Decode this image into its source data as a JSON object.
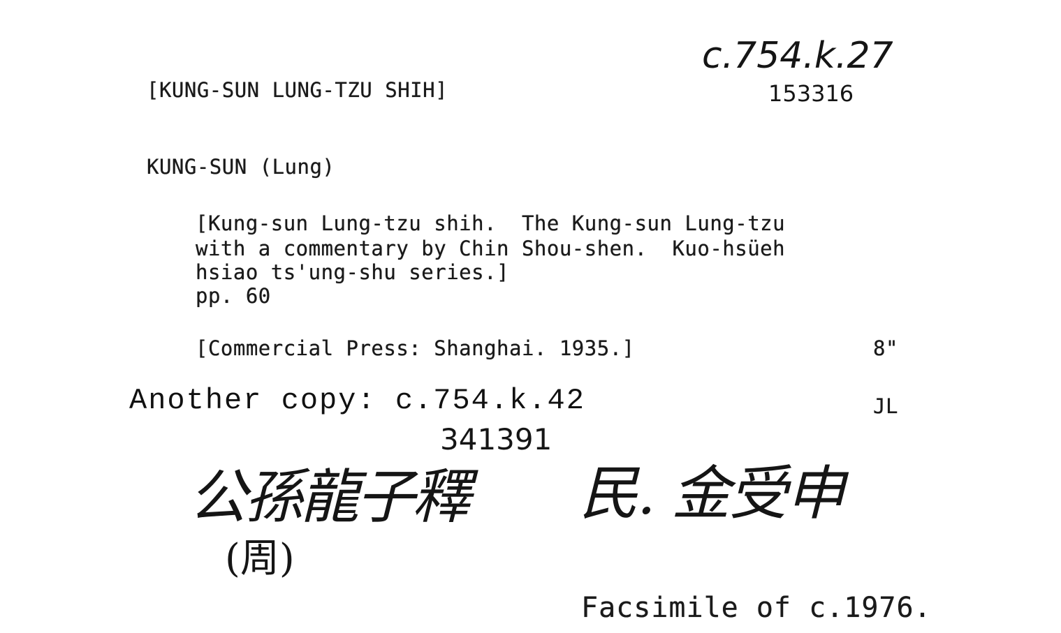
{
  "card": {
    "shelfmark_handwritten": "c.754.k.27",
    "accession_number": "153316",
    "heading_title": "[KUNG-SUN LUNG-TZU SHIH]",
    "author_heading": "KUNG-SUN (Lung)",
    "description_line1": "[Kung-sun Lung-tzu shih.  The Kung-sun Lung-tzu",
    "description_line2": "with a commentary by Chin Shou-shen.  Kuo-hsüeh",
    "description_line3": "hsiao ts'ung-shu series.]",
    "pagination": "pp. 60",
    "imprint": "[Commercial Press: Shanghai. 1935.]",
    "size": "8\"",
    "another_copy": "Another copy: c.754.k.42",
    "cataloguer_initials": "JL",
    "another_copy_accession": "341391",
    "chinese_title": "公孫龍子釋",
    "chinese_author": "民. 金受申",
    "chinese_dynasty": "(周)",
    "facsimile_note": "Facsimile of c.1976."
  }
}
